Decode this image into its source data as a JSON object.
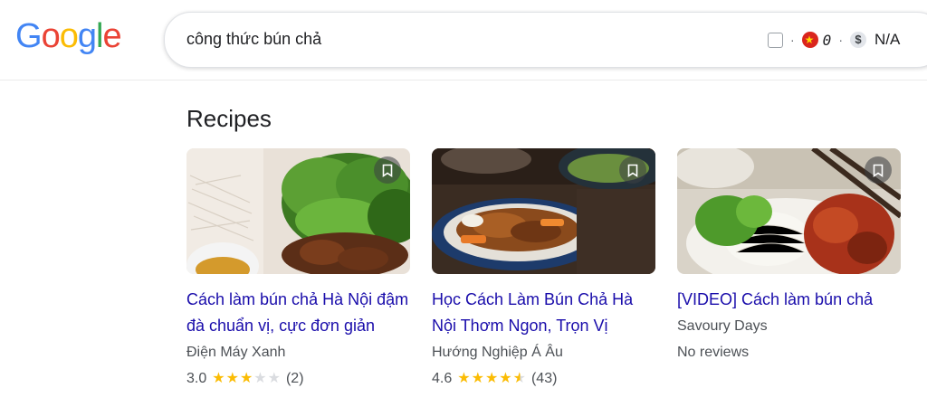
{
  "header": {
    "logo_letters": [
      {
        "char": "G",
        "color": "#4285F4"
      },
      {
        "char": "o",
        "color": "#EA4335"
      },
      {
        "char": "o",
        "color": "#FBBC05"
      },
      {
        "char": "g",
        "color": "#4285F4"
      },
      {
        "char": "l",
        "color": "#34A853"
      },
      {
        "char": "e",
        "color": "#EA4335"
      }
    ],
    "search": {
      "query": "công thức bún chả"
    },
    "extension": {
      "flag_count": "0",
      "price_value": "N/A",
      "separator": "·",
      "dollar_symbol": "$"
    }
  },
  "recipes": {
    "section_title": "Recipes",
    "cards": [
      {
        "title": "Cách làm bún chả Hà Nội đậm đà chuẩn vị, cực đơn giản",
        "source": "Điện Máy Xanh",
        "rating": "3.0",
        "stars": [
          "full",
          "full",
          "full",
          "empty",
          "empty"
        ],
        "review_count": "(2)",
        "has_rating": true
      },
      {
        "title": "Học Cách Làm Bún Chả Hà Nội Thơm Ngon, Trọn Vị",
        "source": "Hướng Nghiệp Á Âu",
        "rating": "4.6",
        "stars": [
          "full",
          "full",
          "full",
          "full",
          "half"
        ],
        "review_count": "(43)",
        "has_rating": true
      },
      {
        "title": "[VIDEO] Cách làm bún chả",
        "source": "Savoury Days",
        "no_reviews_text": "No reviews",
        "has_rating": false
      }
    ]
  }
}
